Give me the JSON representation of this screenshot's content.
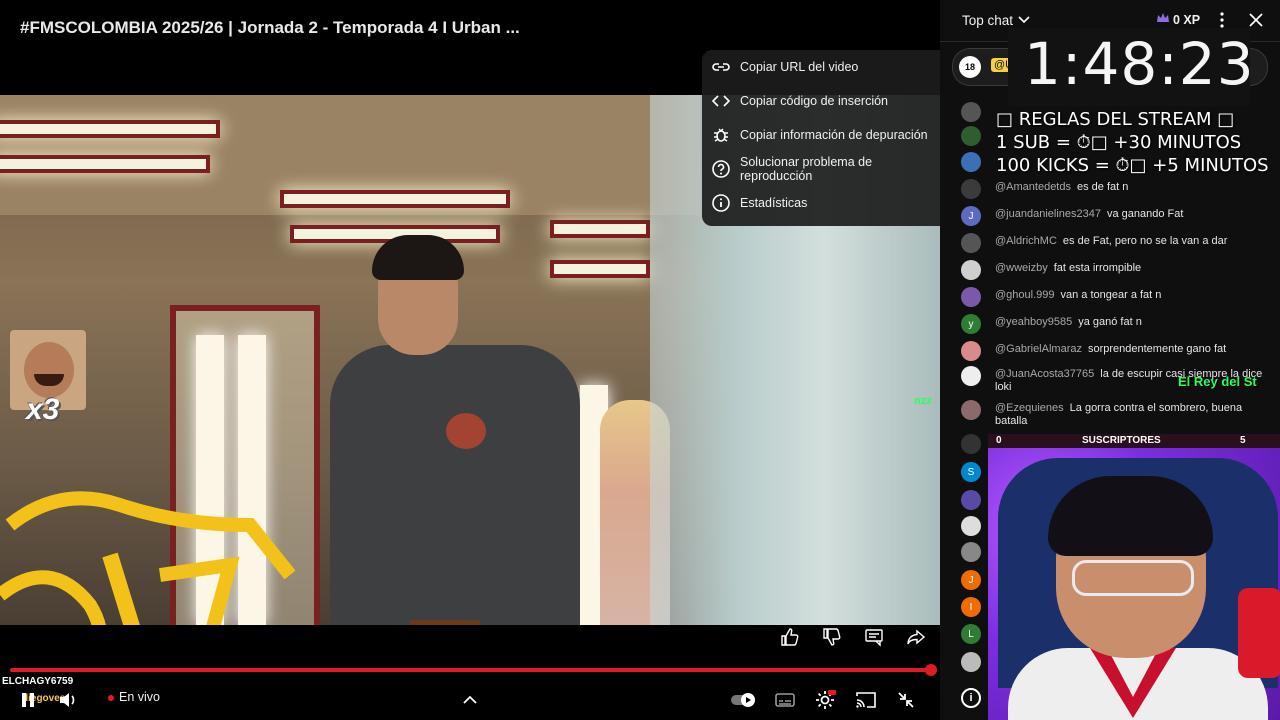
{
  "video": {
    "title": "#FMSCOLOMBIA 2025/26 | Jornada 2 - Temporada 4 I Urban ...",
    "emote_count": "x3",
    "green_tag": "nzz"
  },
  "context_menu": {
    "items": [
      {
        "label": "Copiar URL del video",
        "icon": "link-icon"
      },
      {
        "label": "Copiar código de inserción",
        "icon": "embed-code-icon"
      },
      {
        "label": "Copiar información de depuración",
        "icon": "bug-icon"
      },
      {
        "label": "Solucionar problema de reproducción",
        "icon": "help-circle-icon"
      },
      {
        "label": "Estadísticas",
        "icon": "info-icon"
      }
    ]
  },
  "player": {
    "live_label": "En vivo",
    "progress": 1.0,
    "donor_a": "ELCHAGY6759",
    "donor_b": "diegoves",
    "accent": "#e01b24"
  },
  "chat": {
    "mode": "Top chat",
    "xp": "0 XP",
    "pinned_user": "@U",
    "pinned_avatar": "18",
    "timer": "1:48:23",
    "rules": [
      "□ REGLAS DEL STREAM □",
      "1 SUB = ⏱□ +30 MINUTOS",
      "100 KICKS = ⏱□ +5 MINUTOS"
    ],
    "messages": [
      {
        "user": "@Amantedetds",
        "text": "es de fat n",
        "avatar": "",
        "color": "#3b3b3b"
      },
      {
        "user": "@juandanielines2347",
        "text": "va ganando Fat",
        "avatar": "J",
        "color": "#5c6bc0"
      },
      {
        "user": "@AldrichMC",
        "text": "es de Fat, pero no se la van a dar",
        "avatar": "",
        "color": "#555555"
      },
      {
        "user": "@wweizby",
        "text": "fat esta irrompible",
        "avatar": "",
        "color": "#cfcfcf"
      },
      {
        "user": "@ghoul.999",
        "text": "van a tongear a fat n",
        "avatar": "",
        "color": "#7a5aa8"
      },
      {
        "user": "@yeahboy9585",
        "text": "ya ganó fat n",
        "avatar": "y",
        "color": "#2e7d32"
      },
      {
        "user": "@GabrielAlmaraz",
        "text": "sorprendentemente gano fat",
        "avatar": "",
        "color": "#d98a8a"
      },
      {
        "user": "@JuanAcosta37765",
        "text": "la de escupir casi siempre la dice loki",
        "avatar": "",
        "color": "#eeeeee"
      },
      {
        "user": "@Ezequienes",
        "text": "La gorra contra el sombrero, buena batalla",
        "avatar": "",
        "color": "#8a6a6a"
      }
    ],
    "overlay_name": "El Rey del St",
    "sub_bar": {
      "left": "0",
      "title": "SUSCRIPTORES",
      "right": "5"
    },
    "side_avatars": [
      {
        "letter": "",
        "color": "#333333"
      },
      {
        "letter": "S",
        "color": "#0288d1"
      },
      {
        "letter": "",
        "color": "#5a4aa8"
      },
      {
        "letter": "",
        "color": "#dddddd"
      },
      {
        "letter": "",
        "color": "#888888"
      },
      {
        "letter": "J",
        "color": "#ef6c00"
      },
      {
        "letter": "I",
        "color": "#ef6c00"
      },
      {
        "letter": "L",
        "color": "#2e7d32"
      },
      {
        "letter": "",
        "color": "#bbbbbb"
      }
    ]
  }
}
